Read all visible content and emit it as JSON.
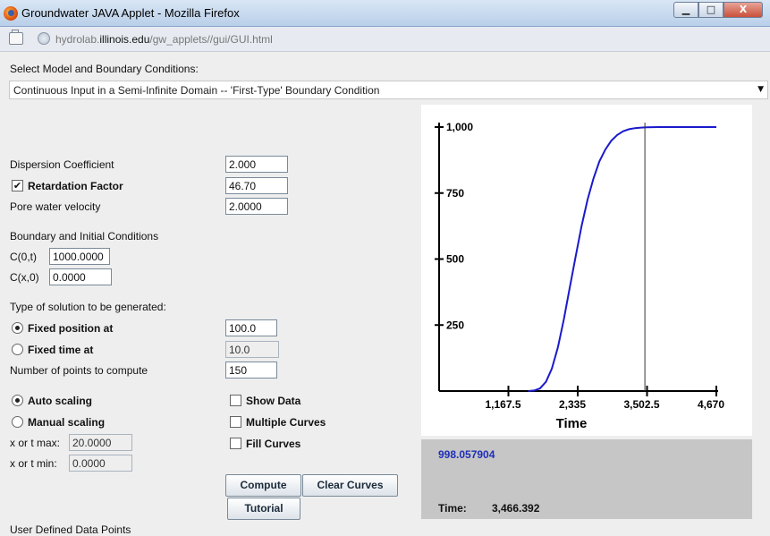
{
  "window": {
    "title": "Groundwater JAVA Applet - Mozilla Firefox",
    "controls": {
      "minimize": "▁",
      "maximize": "□",
      "close": "X"
    }
  },
  "address": {
    "url_prefix": "hydrolab.",
    "url_domain": "illinois.edu",
    "url_path": "/gw_applets//gui/GUI.html"
  },
  "model": {
    "label": "Select Model and Boundary Conditions:",
    "selected": "Continuous Input in a Semi-Infinite Domain -- 'First-Type' Boundary Condition"
  },
  "parameters": {
    "dispersion_label": "Dispersion Coefficient",
    "dispersion_value": "2.000",
    "retardation_label": "Retardation Factor",
    "retardation_checked": true,
    "retardation_value": "46.70",
    "velocity_label": "Pore water velocity",
    "velocity_value": "2.0000"
  },
  "boundary": {
    "heading": "Boundary and Initial Conditions",
    "c0t_label": "C(0,t)",
    "c0t_value": "1000.0000",
    "cx0_label": "C(x,0)",
    "cx0_value": "0.0000"
  },
  "solution": {
    "heading": "Type of solution to be generated:",
    "fixed_position_label": "Fixed position at",
    "fixed_position_value": "100.0",
    "fixed_position_selected": true,
    "fixed_time_label": "Fixed time at",
    "fixed_time_value": "10.0",
    "points_label": "Number of points to compute",
    "points_value": "150"
  },
  "scaling": {
    "auto_label": "Auto scaling",
    "auto_selected": true,
    "manual_label": "Manual scaling",
    "xmax_label": "x or t max:",
    "xmax_value": "20.0000",
    "xmin_label": "x or t min:",
    "xmin_value": "0.0000"
  },
  "options": {
    "show_data": "Show Data",
    "multiple_curves": "Multiple Curves",
    "fill_curves": "Fill Curves"
  },
  "buttons": {
    "compute": "Compute",
    "clear_curves": "Clear Curves",
    "tutorial": "Tutorial"
  },
  "user_points_label": "User Defined Data Points",
  "readout": {
    "value": "998.057904",
    "time_label": "Time:",
    "time_value": "3,466.392"
  },
  "chart_data": {
    "type": "line",
    "xlabel": "Time",
    "ylabel": "",
    "xlim": [
      0,
      4670
    ],
    "ylim": [
      0,
      1000
    ],
    "x_ticks": [
      "1,167.5",
      "2,335",
      "3,502.5",
      "4,670"
    ],
    "x_tick_values": [
      1167.5,
      2335,
      3502.5,
      4670
    ],
    "y_ticks": [
      "250",
      "500",
      "750",
      "1,000"
    ],
    "y_tick_values": [
      250,
      500,
      750,
      1000
    ],
    "cursor_x": 3466.392,
    "series_color": "#1a1acc",
    "series": [
      {
        "name": "",
        "x": [
          0,
          1500,
          1600,
          1700,
          1800,
          1900,
          2000,
          2100,
          2200,
          2300,
          2400,
          2500,
          2600,
          2700,
          2800,
          2900,
          3000,
          3100,
          3200,
          3300,
          3400,
          3500,
          3700,
          4000,
          4300,
          4670
        ],
        "y": [
          0,
          0,
          2,
          10,
          35,
          85,
          165,
          270,
          390,
          510,
          625,
          725,
          805,
          870,
          915,
          948,
          970,
          984,
          992,
          996,
          998,
          999,
          1000,
          1000,
          1000,
          1000
        ]
      }
    ]
  }
}
